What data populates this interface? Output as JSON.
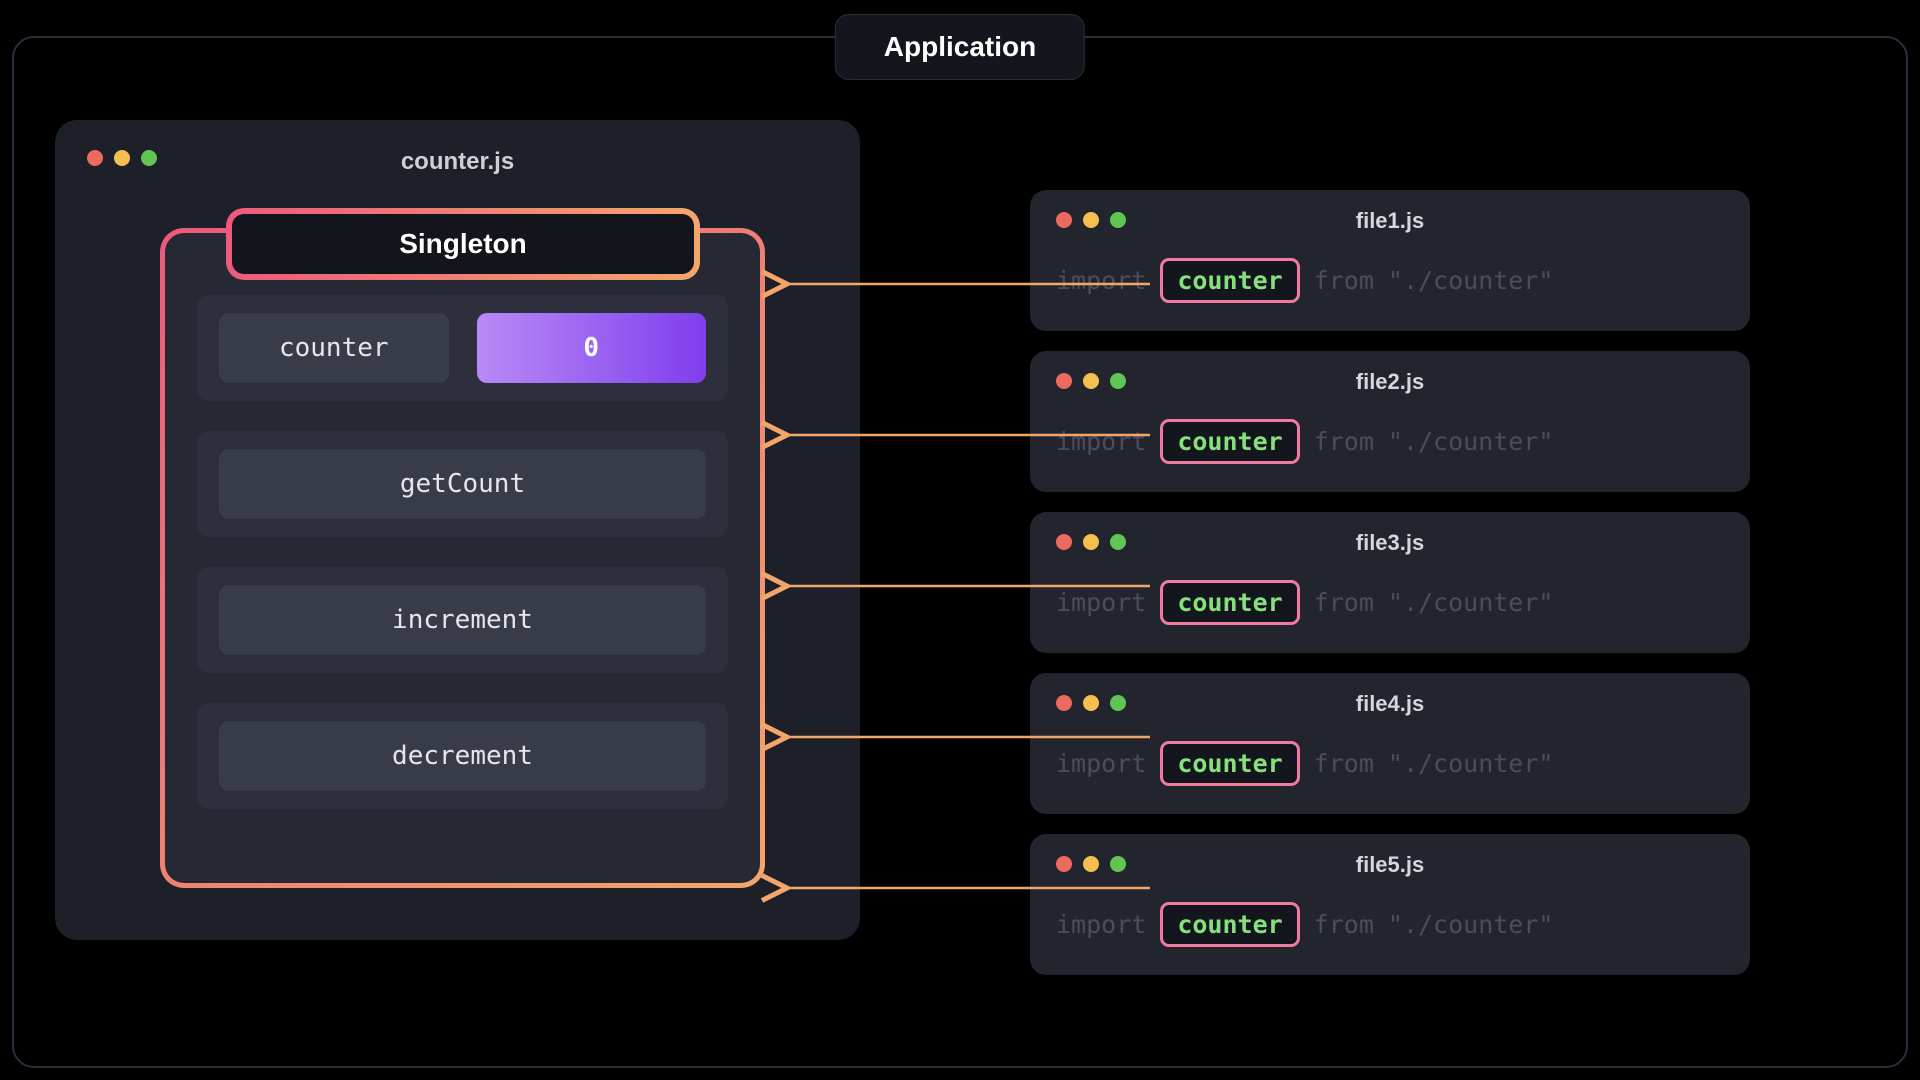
{
  "app_title": "Application",
  "module": {
    "filename": "counter.js",
    "singleton_label": "Singleton",
    "counter_prop": "counter",
    "counter_value": "0",
    "methods": [
      "getCount",
      "increment",
      "decrement"
    ]
  },
  "files": [
    {
      "name": "file1.js",
      "import_kw": "import",
      "ident": "counter",
      "from_kw": "from",
      "path": "\"./counter\""
    },
    {
      "name": "file2.js",
      "import_kw": "import",
      "ident": "counter",
      "from_kw": "from",
      "path": "\"./counter\""
    },
    {
      "name": "file3.js",
      "import_kw": "import",
      "ident": "counter",
      "from_kw": "from",
      "path": "\"./counter\""
    },
    {
      "name": "file4.js",
      "import_kw": "import",
      "ident": "counter",
      "from_kw": "from",
      "path": "\"./counter\""
    },
    {
      "name": "file5.js",
      "import_kw": "import",
      "ident": "counter",
      "from_kw": "from",
      "path": "\"./counter\""
    }
  ],
  "colors": {
    "gradient_pink": "#ec5a7d",
    "gradient_orange": "#f3a66a",
    "purple_a": "#b98af6",
    "purple_b": "#7f3eed",
    "pill_border": "#f07ba1",
    "pill_text": "#86e07c"
  }
}
